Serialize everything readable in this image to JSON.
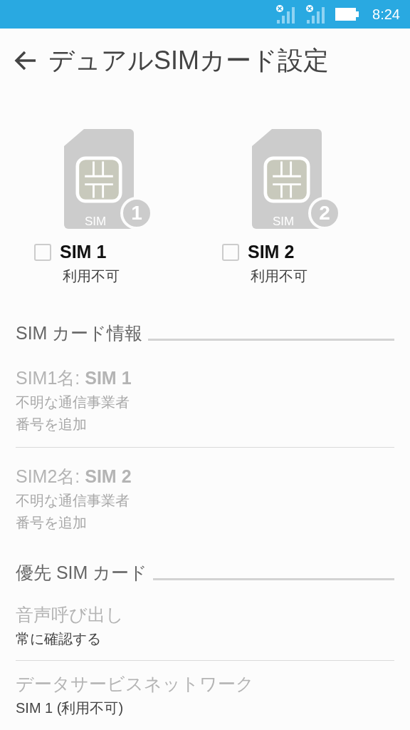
{
  "status_bar": {
    "time": "8:24"
  },
  "header": {
    "title": "デュアルSIMカード設定"
  },
  "sims": [
    {
      "card_label": "SIM",
      "badge": "1",
      "name": "SIM 1",
      "status": "利用不可",
      "checked": false
    },
    {
      "card_label": "SIM",
      "badge": "2",
      "name": "SIM 2",
      "status": "利用不可",
      "checked": false
    }
  ],
  "sim_info": {
    "heading": "SIM カード情報",
    "items": [
      {
        "name": "SIM1名: **SIM 1**",
        "carrier": "不明な通信事業者",
        "number": "番号を追加",
        "disabled": true
      },
      {
        "name": "SIM2名: **SIM 2**",
        "carrier": "不明な通信事業者",
        "number": "番号を追加",
        "disabled": true
      }
    ]
  },
  "preferred": {
    "heading": "優先 SIM カード",
    "items": [
      {
        "title": "音声呼び出し",
        "value": "常に確認する",
        "disabled": true
      },
      {
        "title": "データサービスネットワーク",
        "value": "SIM 1 (利用不可)",
        "disabled": true
      }
    ]
  }
}
